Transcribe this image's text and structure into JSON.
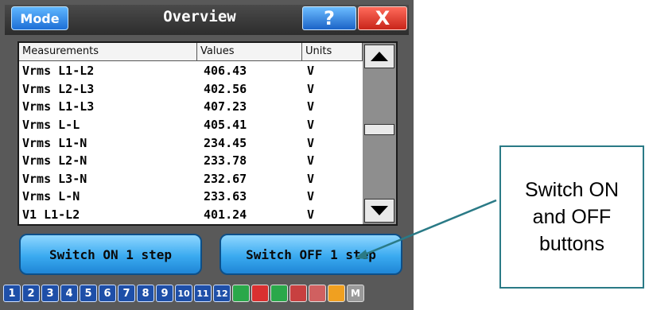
{
  "header": {
    "mode_label": "Mode",
    "title": "Overview",
    "help_label": "?",
    "close_label": "X"
  },
  "table": {
    "columns": [
      "Measurements",
      "Values",
      "Units"
    ],
    "rows": [
      [
        "Vrms L1-L2",
        "406.43",
        "V"
      ],
      [
        "Vrms L2-L3",
        "402.56",
        "V"
      ],
      [
        "Vrms L1-L3",
        "407.23",
        "V"
      ],
      [
        "Vrms L-L",
        "405.41",
        "V"
      ],
      [
        "Vrms L1-N",
        "234.45",
        "V"
      ],
      [
        "Vrms L2-N",
        "233.78",
        "V"
      ],
      [
        "Vrms L3-N",
        "232.67",
        "V"
      ],
      [
        "Vrms L-N",
        "233.63",
        "V"
      ],
      [
        "V1 L1-L2",
        "401.24",
        "V"
      ]
    ]
  },
  "buttons": {
    "switch_on": "Switch ON 1 step",
    "switch_off": "Switch OFF 1 step"
  },
  "steps": [
    "1",
    "2",
    "3",
    "4",
    "5",
    "6",
    "7",
    "8",
    "9",
    "10",
    "11",
    "12"
  ],
  "status_icons": [
    {
      "name": "lock-icon",
      "color": "#2aa84a"
    },
    {
      "name": "alarm-icon",
      "color": "#d93030"
    },
    {
      "name": "temperature-icon",
      "color": "#2aa84a"
    },
    {
      "name": "phase-icon",
      "color": "#c84040"
    },
    {
      "name": "fault-icon",
      "color": "#d06060"
    },
    {
      "name": "sun-icon",
      "color": "#f0a020"
    },
    {
      "name": "manual-icon",
      "color": "#9a9a9a",
      "label": "M"
    }
  ],
  "annotation": {
    "text": "Switch ON and OFF buttons",
    "color": "#2a7a86"
  },
  "colors": {
    "accent_blue": "#3aaaf0",
    "close_red": "#c8251a"
  }
}
